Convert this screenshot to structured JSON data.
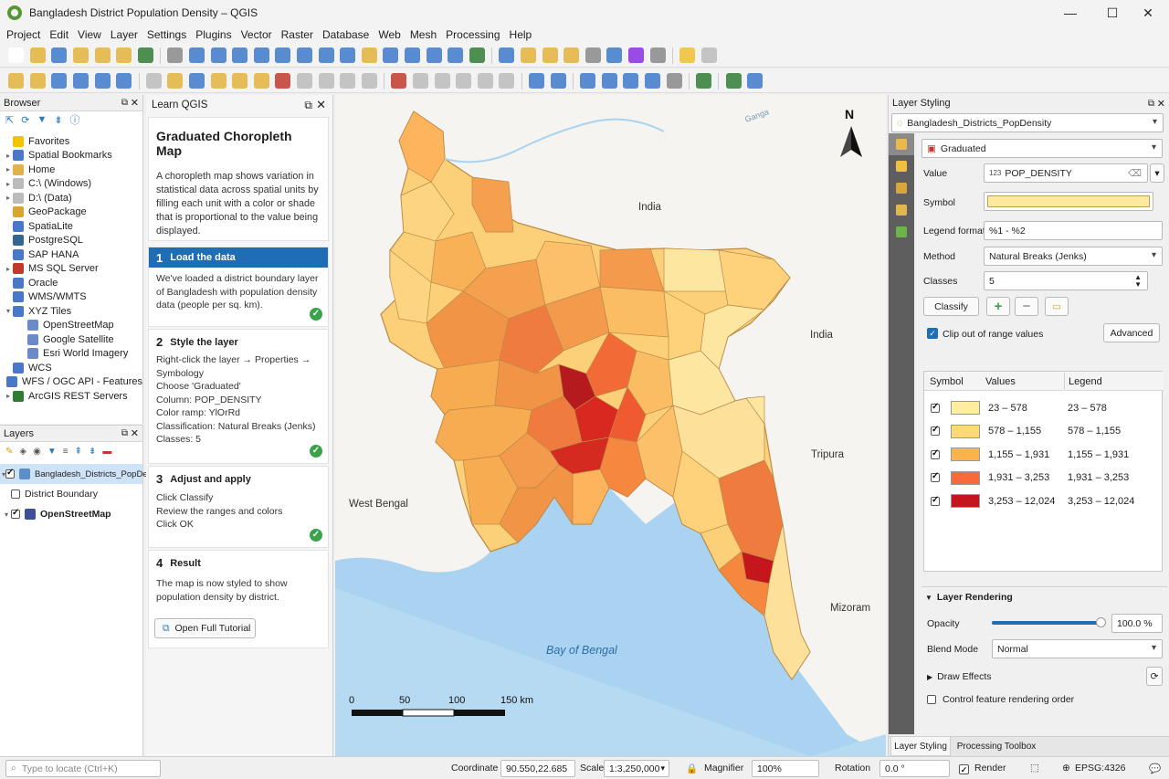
{
  "window": {
    "title": "Bangladesh District Population Density – QGIS"
  },
  "menu": [
    "Project",
    "Edit",
    "View",
    "Layer",
    "Settings",
    "Plugins",
    "Vector",
    "Raster",
    "Database",
    "Web",
    "Mesh",
    "Processing",
    "Help"
  ],
  "browser": {
    "title": "Browser",
    "items": [
      {
        "label": "Favorites",
        "icon": "star-icon",
        "expander": false
      },
      {
        "label": "Spatial Bookmarks",
        "icon": "bookmark-icon",
        "expander": true
      },
      {
        "label": "Home",
        "icon": "folder-icon",
        "expander": true
      },
      {
        "label": "C:\\ (Windows)",
        "icon": "drive-icon",
        "expander": true
      },
      {
        "label": "D:\\ (Data)",
        "icon": "drive-icon",
        "expander": true
      },
      {
        "label": "GeoPackage",
        "icon": "geopackage-icon",
        "expander": false
      },
      {
        "label": "SpatiaLite",
        "icon": "spatialite-icon",
        "expander": false
      },
      {
        "label": "PostgreSQL",
        "icon": "postgresql-icon",
        "expander": false
      },
      {
        "label": "SAP HANA",
        "icon": "sap-hana-icon",
        "expander": false
      },
      {
        "label": "MS SQL Server",
        "icon": "mssql-icon",
        "expander": true
      },
      {
        "label": "Oracle",
        "icon": "oracle-icon",
        "expander": false
      },
      {
        "label": "WMS/WMTS",
        "icon": "wms-icon",
        "expander": false
      },
      {
        "label": "XYZ Tiles",
        "icon": "xyz-icon",
        "expander": true,
        "open": true
      },
      {
        "label": "OpenStreetMap",
        "icon": "tiles-icon",
        "child": true
      },
      {
        "label": "Google Satellite",
        "icon": "tiles-icon",
        "child": true
      },
      {
        "label": "Esri World Imagery",
        "icon": "tiles-icon",
        "child": true
      },
      {
        "label": "WCS",
        "icon": "wcs-icon",
        "expander": false
      },
      {
        "label": "WFS / OGC API - Features",
        "icon": "wfs-icon",
        "expander": false
      },
      {
        "label": "ArcGIS REST Servers",
        "icon": "arcgis-icon",
        "expander": true
      }
    ]
  },
  "layers": {
    "title": "Layers",
    "items": [
      {
        "label": "Bangladesh_Districts_PopDensity",
        "checked": true,
        "selected": true
      },
      {
        "label": "District Boundary",
        "checked": false,
        "selected": false
      },
      {
        "label": "OpenStreetMap",
        "checked": true,
        "selected": false
      }
    ]
  },
  "learn": {
    "panel_title": "Learn QGIS",
    "heading": "Graduated Choropleth Map",
    "intro": "A choropleth map shows variation in statistical data across spatial units by filling each unit with a color or shade that is proportional to the value being displayed.",
    "steps": [
      {
        "num": "1",
        "title": "Load the data",
        "lines": [
          "We've loaded a district boundary layer of Bangladesh with population density data (people per sq. km)."
        ]
      },
      {
        "num": "2",
        "title": "Style the layer",
        "lines": [
          "Right-click the layer → Properties → Symbology",
          "Choose 'Graduated'",
          "Column: POP_DENSITY",
          "Color ramp: YlOrRd",
          "Classification: Natural Breaks (Jenks)",
          "Classes: 5"
        ]
      },
      {
        "num": "3",
        "title": "Adjust and apply",
        "lines": [
          "Click Classify",
          "Review the ranges and colors",
          "Click OK"
        ]
      },
      {
        "num": "4",
        "title": "Result",
        "lines": [
          "The map is now styled to show population density by district."
        ]
      }
    ],
    "button": "Open Full Tutorial"
  },
  "map": {
    "labels": {
      "india_n": "India",
      "india_e": "India",
      "west_bengal": "West Bengal",
      "tripura": "Tripura",
      "mizoram": "Mizoram",
      "bay": "Bay of Bengal",
      "river": "Ganga",
      "north": "N"
    },
    "scale_ticks": [
      "0",
      "50",
      "100",
      "150 km"
    ]
  },
  "styling": {
    "title": "Layer Styling",
    "layer": "Bangladesh_Districts_PopDensity",
    "renderer": "Graduated",
    "value_label": "Value",
    "value": "POP_DENSITY",
    "value_type": "123",
    "symbol_label": "Symbol",
    "symbol_color": "#fde9a0",
    "legend_format_label": "Legend format",
    "legend_format": "%1 - %2",
    "method_label": "Method",
    "method": "Natural Breaks (Jenks)",
    "classes_label": "Classes",
    "classes": "5",
    "classify": "Classify",
    "clip_label": "Clip out of range values",
    "advanced": "Advanced",
    "table_headers": [
      "Symbol",
      "Values",
      "Legend"
    ],
    "classes_list": [
      {
        "color": "#ffeda0",
        "values": "23 – 578",
        "legend": "23 – 578"
      },
      {
        "color": "#fed976",
        "values": "578 – 1,155",
        "legend": "578 – 1,155"
      },
      {
        "color": "#feb24c",
        "values": "1,155 – 1,931",
        "legend": "1,155 – 1,931"
      },
      {
        "color": "#f76a3a",
        "values": "1,931 – 3,253",
        "legend": "1,931 – 3,253"
      },
      {
        "color": "#c4161c",
        "values": "3,253 – 12,024",
        "legend": "3,253 – 12,024"
      }
    ],
    "layer_rendering": "Layer Rendering",
    "opacity_label": "Opacity",
    "opacity": "100.0 %",
    "opacity_fraction": 1.0,
    "blend_label": "Blend Mode",
    "blend": "Normal",
    "draw_effects": "Draw Effects",
    "control_order": "Control feature rendering order",
    "tabs": [
      "Layer Styling",
      "Processing Toolbox"
    ]
  },
  "status": {
    "locate_placeholder": "Type to locate (Ctrl+K)",
    "coordinate_label": "Coordinate",
    "coordinate": "90.550,22.685",
    "scale_label": "Scale",
    "scale": "1:3,250,000",
    "magnifier_label": "Magnifier",
    "magnifier": "100%",
    "rotation_label": "Rotation",
    "rotation": "0.0 °",
    "render_label": "Render",
    "crs": "EPSG:4326"
  }
}
